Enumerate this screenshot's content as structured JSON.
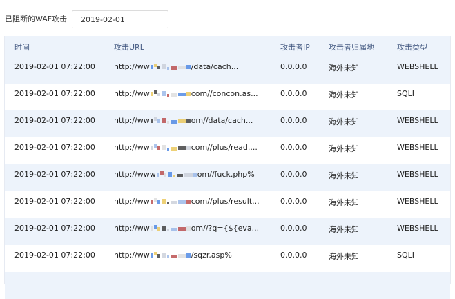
{
  "filter": {
    "label": "已阻断的WAF攻击",
    "date_value": "2019-02-01"
  },
  "table": {
    "columns": [
      "时间",
      "攻击URL",
      "攻击者IP",
      "攻击者归属地",
      "攻击类型"
    ],
    "rows": [
      {
        "time": "2019-02-01 07:22:00",
        "url_prefix": "http://ww",
        "url_suffix": "/data/cach...",
        "ip": "0.0.0.0",
        "location": "海外未知",
        "type": "WEBSHELL"
      },
      {
        "time": "2019-02-01 07:22:00",
        "url_prefix": "http://ww",
        "url_suffix": "com//concon.as...",
        "ip": "0.0.0.0",
        "location": "海外未知",
        "type": "SQLI"
      },
      {
        "time": "2019-02-01 07:22:00",
        "url_prefix": "http://ww",
        "url_suffix": "om//data/cach...",
        "ip": "0.0.0.0",
        "location": "海外未知",
        "type": "WEBSHELL"
      },
      {
        "time": "2019-02-01 07:22:00",
        "url_prefix": "http://ww",
        "url_suffix": "com//plus/read....",
        "ip": "0.0.0.0",
        "location": "海外未知",
        "type": "WEBSHELL"
      },
      {
        "time": "2019-02-01 07:22:00",
        "url_prefix": "http://www",
        "url_suffix": "om//fuck.php%",
        "ip": "0.0.0.0",
        "location": "海外未知",
        "type": "WEBSHELL"
      },
      {
        "time": "2019-02-01 07:22:00",
        "url_prefix": "http://ww",
        "url_suffix": "com//plus/result...",
        "ip": "0.0.0.0",
        "location": "海外未知",
        "type": "WEBSHELL"
      },
      {
        "time": "2019-02-01 07:22:00",
        "url_prefix": "http://ww",
        "url_suffix": "om//?q={${eva...",
        "ip": "0.0.0.0",
        "location": "海外未知",
        "type": "WEBSHELL"
      },
      {
        "time": "2019-02-01 07:22:00",
        "url_prefix": "http://ww",
        "url_suffix": "/sqzr.asp%",
        "ip": "0.0.0.0",
        "location": "海外未知",
        "type": "SQLI"
      }
    ]
  }
}
